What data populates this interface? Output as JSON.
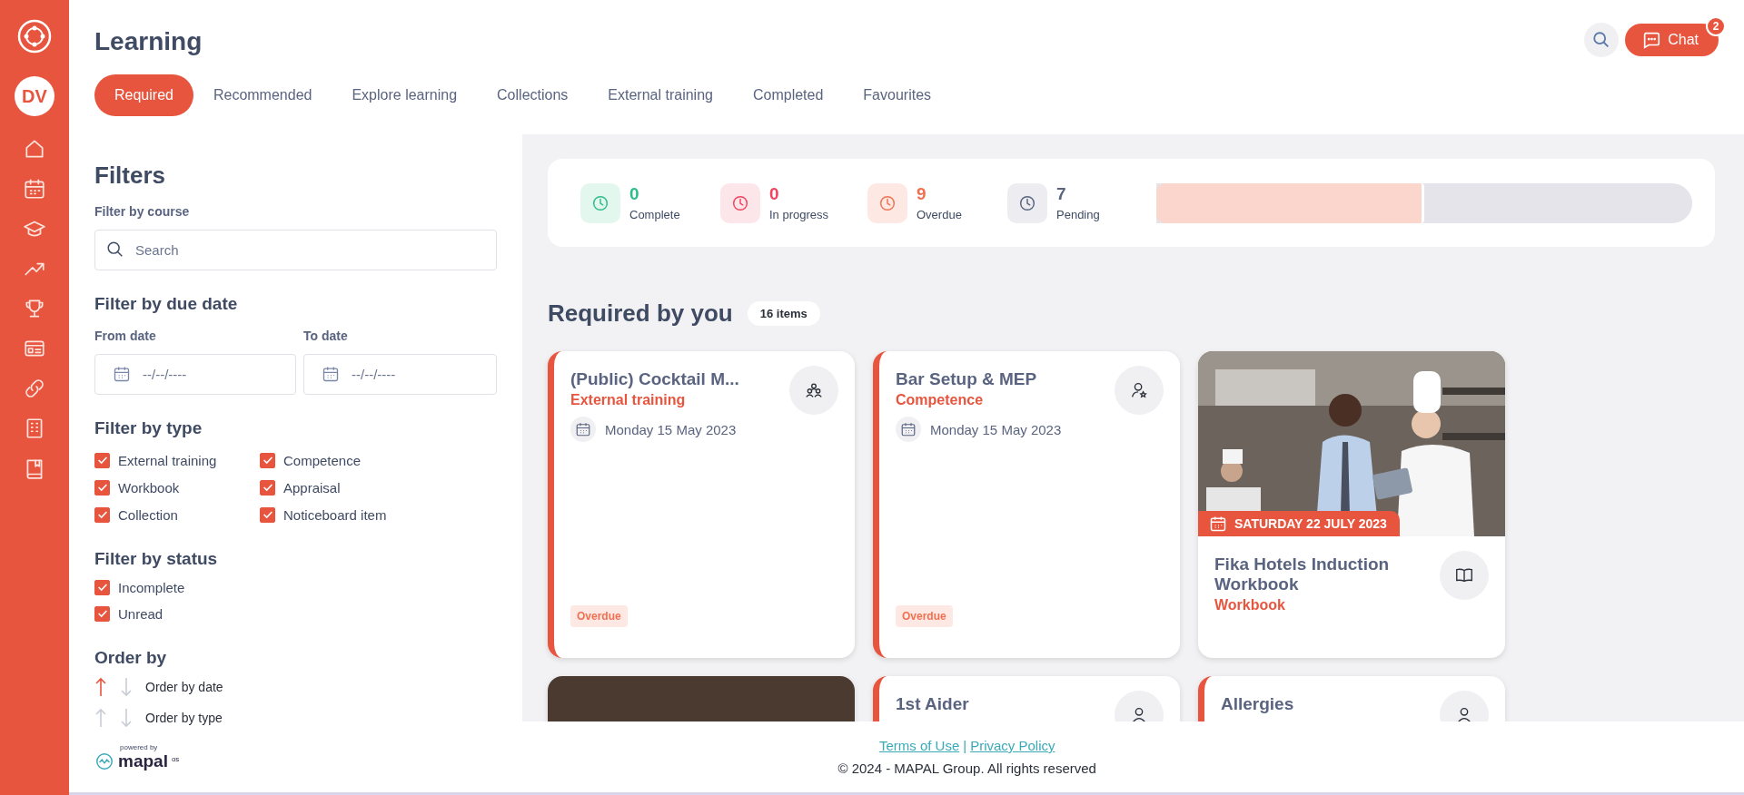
{
  "sidebar": {
    "avatar": "DV",
    "items": [
      {
        "kind": "home"
      },
      {
        "kind": "calendar"
      },
      {
        "kind": "graduation"
      },
      {
        "kind": "trend"
      },
      {
        "kind": "trophy"
      },
      {
        "kind": "news"
      },
      {
        "kind": "link"
      },
      {
        "kind": "building"
      },
      {
        "kind": "book"
      }
    ]
  },
  "header": {
    "title": "Learning",
    "chat": {
      "label": "Chat",
      "badge": "2"
    }
  },
  "tabs": [
    {
      "label": "Required",
      "selected": true
    },
    {
      "label": "Recommended",
      "selected": false
    },
    {
      "label": "Explore learning",
      "selected": false
    },
    {
      "label": "Collections",
      "selected": false
    },
    {
      "label": "External training",
      "selected": false
    },
    {
      "label": "Completed",
      "selected": false
    },
    {
      "label": "Favourites",
      "selected": false
    }
  ],
  "filters": {
    "title": "Filters",
    "course_label": "Filter by course",
    "search": {
      "placeholder": "Search"
    },
    "due_title": "Filter by due date",
    "from": {
      "label": "From date",
      "placeholder": "--/--/----"
    },
    "to": {
      "label": "To date",
      "placeholder": "--/--/----"
    },
    "type_title": "Filter by type",
    "types": [
      {
        "label": "External training",
        "checked": true
      },
      {
        "label": "Competence",
        "checked": true
      },
      {
        "label": "Workbook",
        "checked": true
      },
      {
        "label": "Appraisal",
        "checked": true
      },
      {
        "label": "Collection",
        "checked": true
      },
      {
        "label": "Noticeboard item",
        "checked": true
      }
    ],
    "status_title": "Filter by status",
    "statuses": [
      {
        "label": "Incomplete",
        "checked": true
      },
      {
        "label": "Unread",
        "checked": true
      }
    ],
    "order_title": "Order by",
    "order": [
      {
        "label": "Order by date",
        "up_selected": true,
        "down_selected": false
      },
      {
        "label": "Order by type",
        "up_selected": false,
        "down_selected": false
      }
    ]
  },
  "stats": {
    "items": [
      {
        "kind": "complete",
        "value": "0",
        "label": "Complete",
        "color": "#2dbd8a"
      },
      {
        "kind": "in_progress",
        "value": "0",
        "label": "In progress",
        "color": "#f0445f"
      },
      {
        "kind": "overdue",
        "value": "9",
        "label": "Overdue",
        "color": "#f07152"
      },
      {
        "kind": "pending",
        "value": "7",
        "label": "Pending",
        "color": "#5a6480"
      }
    ],
    "level": 0.5
  },
  "section": {
    "title": "Required by you",
    "count": "16 items"
  },
  "cards": [
    {
      "kind": "text",
      "title": "(Public) Cocktail M...",
      "type": "External training",
      "date": "Monday 15 May 2023",
      "status": "Overdue",
      "flagged": true
    },
    {
      "kind": "text",
      "title": "Bar Setup & MEP",
      "type": "Competence",
      "date": "Monday 15 May 2023",
      "status": "Overdue",
      "flagged": true
    },
    {
      "kind": "picture",
      "title": "Fika Hotels Induction Workbook",
      "type": "Workbook",
      "date": "SATURDAY 22 JULY 2023",
      "flagged": false
    },
    {
      "kind": "picture",
      "flagged": false
    },
    {
      "kind": "text",
      "title": "1st Aider",
      "flagged": true
    },
    {
      "kind": "text",
      "title": "Allergies",
      "flagged": true
    }
  ],
  "footer": {
    "powered": "powered by",
    "brand": "mapal",
    "brand_suffix": "os",
    "links": [
      "Terms of Use",
      "Privacy Policy"
    ],
    "separator": "|",
    "copyright": "© 2024 - MAPAL Group. All rights reserved"
  }
}
